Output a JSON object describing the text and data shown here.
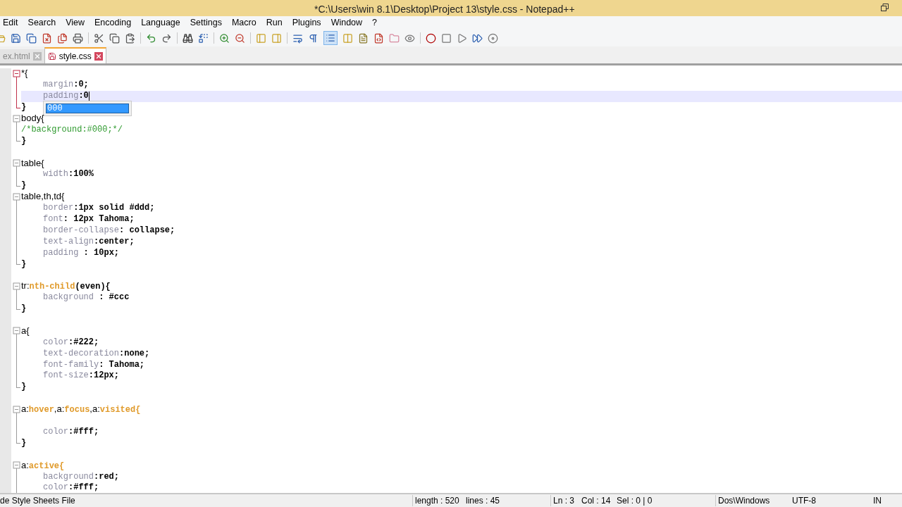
{
  "window": {
    "title": "*C:\\Users\\win 8.1\\Desktop\\Project 13\\style.css - Notepad++"
  },
  "menu": [
    "Edit",
    "Search",
    "View",
    "Encoding",
    "Language",
    "Settings",
    "Macro",
    "Run",
    "Plugins",
    "Window",
    "?"
  ],
  "tabs": [
    {
      "label": "ex.html",
      "selected": false
    },
    {
      "label": "style.css",
      "selected": true
    }
  ],
  "editor": {
    "lines": [
      {
        "kind": "open",
        "current": false,
        "tokens": [
          {
            "kind": "selector",
            "text": "*{"
          }
        ]
      },
      {
        "kind": "line",
        "current": false,
        "tokens": [
          {
            "kind": "property",
            "text": "margin"
          },
          {
            "kind": "value",
            "text": ":0;"
          }
        ]
      },
      {
        "kind": "line",
        "current": true,
        "tokens": [
          {
            "kind": "property",
            "text": "padding"
          },
          {
            "kind": "value",
            "text": ":0"
          }
        ]
      },
      {
        "kind": "end",
        "current": false,
        "tokens": [
          {
            "kind": "value",
            "text": "}"
          }
        ]
      },
      {
        "kind": "open",
        "current": false,
        "tokens": [
          {
            "kind": "selector",
            "text": "body{"
          }
        ]
      },
      {
        "kind": "line",
        "current": false,
        "tokens": [
          {
            "kind": "comment",
            "text": "/*background:#000;*/"
          }
        ]
      },
      {
        "kind": "end",
        "current": false,
        "tokens": [
          {
            "kind": "value",
            "text": "}"
          }
        ]
      },
      {
        "kind": "blank",
        "current": false
      },
      {
        "kind": "open",
        "current": false,
        "tokens": [
          {
            "kind": "selector",
            "text": "table{"
          }
        ]
      },
      {
        "kind": "line",
        "current": false,
        "tokens": [
          {
            "kind": "property",
            "text": "width"
          },
          {
            "kind": "value",
            "text": ":100%"
          }
        ]
      },
      {
        "kind": "end",
        "current": false,
        "tokens": [
          {
            "kind": "value",
            "text": "}"
          }
        ]
      },
      {
        "kind": "open",
        "current": false,
        "tokens": [
          {
            "kind": "selector",
            "text": "table,th,td{"
          }
        ]
      },
      {
        "kind": "line",
        "current": false,
        "tokens": [
          {
            "kind": "property",
            "text": "border"
          },
          {
            "kind": "value",
            "text": ":1px solid #ddd;"
          }
        ]
      },
      {
        "kind": "line",
        "current": false,
        "tokens": [
          {
            "kind": "property",
            "text": "font"
          },
          {
            "kind": "value",
            "text": ": 12px Tahoma;"
          }
        ]
      },
      {
        "kind": "line",
        "current": false,
        "tokens": [
          {
            "kind": "property",
            "text": "border-collapse"
          },
          {
            "kind": "value",
            "text": ": collapse;"
          }
        ]
      },
      {
        "kind": "line",
        "current": false,
        "tokens": [
          {
            "kind": "property",
            "text": "text-align"
          },
          {
            "kind": "value",
            "text": ":center;"
          }
        ]
      },
      {
        "kind": "line",
        "current": false,
        "tokens": [
          {
            "kind": "property",
            "text": "padding"
          },
          {
            "kind": "value",
            "text": " : 10px;"
          }
        ]
      },
      {
        "kind": "end",
        "current": false,
        "tokens": [
          {
            "kind": "value",
            "text": "}"
          }
        ]
      },
      {
        "kind": "blank",
        "current": false
      },
      {
        "kind": "open",
        "current": false,
        "tokens": [
          {
            "kind": "selector",
            "text": "tr:"
          },
          {
            "kind": "pseudo",
            "text": "nth-child"
          },
          {
            "kind": "value",
            "text": "(even){"
          }
        ]
      },
      {
        "kind": "line",
        "current": false,
        "tokens": [
          {
            "kind": "property",
            "text": "background"
          },
          {
            "kind": "value",
            "text": " : #ccc"
          }
        ]
      },
      {
        "kind": "end",
        "current": false,
        "tokens": [
          {
            "kind": "value",
            "text": "}"
          }
        ]
      },
      {
        "kind": "blank",
        "current": false
      },
      {
        "kind": "open",
        "current": false,
        "tokens": [
          {
            "kind": "selector",
            "text": "a{"
          }
        ]
      },
      {
        "kind": "line",
        "current": false,
        "tokens": [
          {
            "kind": "property",
            "text": "color"
          },
          {
            "kind": "value",
            "text": ":#222;"
          }
        ]
      },
      {
        "kind": "line",
        "current": false,
        "tokens": [
          {
            "kind": "property",
            "text": "text-decoration"
          },
          {
            "kind": "value",
            "text": ":none;"
          }
        ]
      },
      {
        "kind": "line",
        "current": false,
        "tokens": [
          {
            "kind": "property",
            "text": "font-family"
          },
          {
            "kind": "value",
            "text": ": Tahoma;"
          }
        ]
      },
      {
        "kind": "line",
        "current": false,
        "tokens": [
          {
            "kind": "property",
            "text": "font-size"
          },
          {
            "kind": "value",
            "text": ":12px;"
          }
        ]
      },
      {
        "kind": "end",
        "current": false,
        "tokens": [
          {
            "kind": "value",
            "text": "}"
          }
        ]
      },
      {
        "kind": "blank",
        "current": false
      },
      {
        "kind": "open",
        "current": false,
        "tokens": [
          {
            "kind": "selector",
            "text": "a:"
          },
          {
            "kind": "pseudo",
            "text": "hover"
          },
          {
            "kind": "selector",
            "text": ",a:"
          },
          {
            "kind": "pseudo",
            "text": "focus"
          },
          {
            "kind": "selector",
            "text": ",a:"
          },
          {
            "kind": "pseudo",
            "text": "visited"
          },
          {
            "kind": "pseudo",
            "text": "{"
          }
        ]
      },
      {
        "kind": "line",
        "current": false
      },
      {
        "kind": "line",
        "current": false,
        "tokens": [
          {
            "kind": "property",
            "text": "color"
          },
          {
            "kind": "value",
            "text": ":#fff;"
          }
        ]
      },
      {
        "kind": "end",
        "current": false,
        "tokens": [
          {
            "kind": "value",
            "text": "}"
          }
        ]
      },
      {
        "kind": "blank",
        "current": false
      },
      {
        "kind": "open",
        "current": false,
        "tokens": [
          {
            "kind": "selector",
            "text": "a:"
          },
          {
            "kind": "pseudo",
            "text": "active{"
          }
        ]
      },
      {
        "kind": "line",
        "current": false,
        "tokens": [
          {
            "kind": "property",
            "text": "background"
          },
          {
            "kind": "value",
            "text": ":red;"
          }
        ]
      },
      {
        "kind": "line",
        "current": false,
        "tokens": [
          {
            "kind": "property",
            "text": "color"
          },
          {
            "kind": "value",
            "text": ":#fff;"
          }
        ]
      }
    ],
    "autocomplete": [
      {
        "text": "000",
        "selected": true
      }
    ]
  },
  "status_bar": {
    "file_type": "de Style Sheets File",
    "length": "length : 520",
    "lines": "lines : 45",
    "ln": "Ln : 3",
    "col": "Col : 14",
    "sel": "Sel : 0 | 0",
    "eol": "Dos\\Windows",
    "encoding": "UTF-8",
    "mode": "IN"
  }
}
